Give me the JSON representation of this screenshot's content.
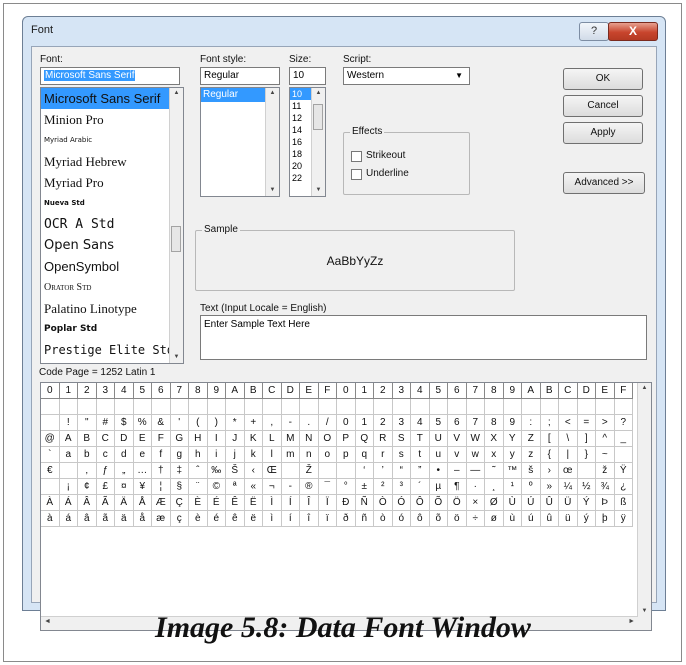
{
  "window": {
    "title": "Font",
    "help_label": "?",
    "close_label": "X"
  },
  "font": {
    "label": "Font:",
    "value": "Microsoft Sans Serif",
    "items": [
      "Microsoft Sans Serif",
      "Minion Pro",
      "Myriad Arabic",
      "Myriad Hebrew",
      "Myriad Pro",
      "Nueva Std",
      "OCR A Std",
      "Open Sans",
      "OpenSymbol",
      "Orator Std",
      "Palatino Linotype",
      "Poplar Std",
      "Prestige Elite Std"
    ],
    "selected_index": 0
  },
  "style": {
    "label": "Font style:",
    "value": "Regular",
    "items": [
      "Regular"
    ],
    "selected_index": 0
  },
  "size": {
    "label": "Size:",
    "value": "10",
    "items": [
      "10",
      "11",
      "12",
      "14",
      "16",
      "18",
      "20",
      "22"
    ],
    "selected_index": 0
  },
  "script": {
    "label": "Script:",
    "value": "Western"
  },
  "effects": {
    "label": "Effects",
    "strikeout": "Strikeout",
    "underline": "Underline"
  },
  "sample": {
    "label": "Sample",
    "text": "AaBbYyZz"
  },
  "text_input": {
    "label": "Text (Input Locale = English)",
    "value": "Enter Sample Text Here"
  },
  "buttons": {
    "ok": "OK",
    "cancel": "Cancel",
    "apply": "Apply",
    "advanced": "Advanced >>"
  },
  "codepage": {
    "label": "Code Page = 1252 Latin 1"
  },
  "grid": {
    "header": [
      "0",
      "1",
      "2",
      "3",
      "4",
      "5",
      "6",
      "7",
      "8",
      "9",
      "A",
      "B",
      "C",
      "D",
      "E",
      "F",
      "0",
      "1",
      "2",
      "3",
      "4",
      "5",
      "6",
      "7",
      "8",
      "9",
      "A",
      "B",
      "C",
      "D",
      "E",
      "F"
    ],
    "rows": [
      [
        " ",
        "!",
        "\"",
        "#",
        "$",
        "%",
        "&",
        "'",
        "(",
        ")",
        "*",
        "+",
        ",",
        "-",
        ".",
        "/",
        "0",
        "1",
        "2",
        "3",
        "4",
        "5",
        "6",
        "7",
        "8",
        "9",
        ":",
        ";",
        "<",
        "=",
        ">",
        "?"
      ],
      [
        "@",
        "A",
        "B",
        "C",
        "D",
        "E",
        "F",
        "G",
        "H",
        "I",
        "J",
        "K",
        "L",
        "M",
        "N",
        "O",
        "P",
        "Q",
        "R",
        "S",
        "T",
        "U",
        "V",
        "W",
        "X",
        "Y",
        "Z",
        "[",
        "\\",
        "]",
        "^",
        "_"
      ],
      [
        "`",
        "a",
        "b",
        "c",
        "d",
        "e",
        "f",
        "g",
        "h",
        "i",
        "j",
        "k",
        "l",
        "m",
        "n",
        "o",
        "p",
        "q",
        "r",
        "s",
        "t",
        "u",
        "v",
        "w",
        "x",
        "y",
        "z",
        "{",
        "|",
        "}",
        "~",
        ""
      ],
      [
        "€",
        "",
        "‚",
        "ƒ",
        "„",
        "…",
        "†",
        "‡",
        "ˆ",
        "‰",
        "Š",
        "‹",
        "Œ",
        "",
        "Ž",
        "",
        "",
        "‘",
        "’",
        "“",
        "”",
        "•",
        "–",
        "—",
        "˜",
        "™",
        "š",
        "›",
        "œ",
        "",
        "ž",
        "Ÿ"
      ],
      [
        " ",
        "¡",
        "¢",
        "£",
        "¤",
        "¥",
        "¦",
        "§",
        "¨",
        "©",
        "ª",
        "«",
        "¬",
        "-",
        "®",
        "¯",
        "°",
        "±",
        "²",
        "³",
        "´",
        "µ",
        "¶",
        "·",
        "¸",
        "¹",
        "º",
        "»",
        "¼",
        "½",
        "¾",
        "¿"
      ],
      [
        "À",
        "Á",
        "Â",
        "Ã",
        "Ä",
        "Å",
        "Æ",
        "Ç",
        "È",
        "É",
        "Ê",
        "Ë",
        "Ì",
        "Í",
        "Î",
        "Ï",
        "Ð",
        "Ñ",
        "Ò",
        "Ó",
        "Ô",
        "Õ",
        "Ö",
        "×",
        "Ø",
        "Ù",
        "Ú",
        "Û",
        "Ü",
        "Ý",
        "Þ",
        "ß"
      ],
      [
        "à",
        "á",
        "â",
        "ã",
        "ä",
        "å",
        "æ",
        "ç",
        "è",
        "é",
        "ê",
        "ë",
        "ì",
        "í",
        "î",
        "ï",
        "ð",
        "ñ",
        "ò",
        "ó",
        "ô",
        "õ",
        "ö",
        "÷",
        "ø",
        "ù",
        "ú",
        "û",
        "ü",
        "ý",
        "þ",
        "ÿ"
      ]
    ]
  },
  "caption": "Image 5.8: Data Font Window",
  "colors": {
    "selection": "#3399ff",
    "window_frame": "#d6e5f5",
    "close_button": "#c8452d"
  },
  "icons": [
    "scroll-up-arrow-icon",
    "scroll-down-arrow-icon",
    "dropdown-arrow-icon",
    "scroll-left-arrow-icon",
    "scroll-right-arrow-icon"
  ]
}
